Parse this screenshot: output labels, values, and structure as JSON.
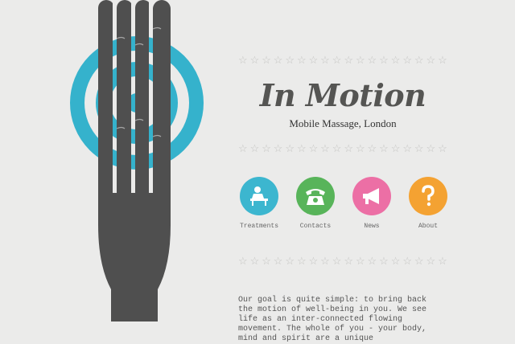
{
  "brand": {
    "title": "In Motion",
    "subtitle": "Mobile Massage, London"
  },
  "nav": {
    "items": [
      {
        "label": "Treatments",
        "icon": "massage-table-icon",
        "color": "#3cb6cf"
      },
      {
        "label": "Contacts",
        "icon": "telephone-icon",
        "color": "#58b45a"
      },
      {
        "label": "News",
        "icon": "megaphone-icon",
        "color": "#ec6fa5"
      },
      {
        "label": "About",
        "icon": "question-mark-icon",
        "color": "#f4a232"
      }
    ]
  },
  "intro": {
    "text": "Our goal is quite simple: to bring back the motion of well-being in you. We see life as an inter-connected flowing movement. The whole of you - your body, mind and spirit are a unique"
  },
  "colors": {
    "background": "#ebebea",
    "hand": "#4f4f4f",
    "rings": "#35b2cc",
    "stars": "#c4c4c2",
    "title": "#555553"
  },
  "decor": {
    "star_glyph": "☆"
  }
}
